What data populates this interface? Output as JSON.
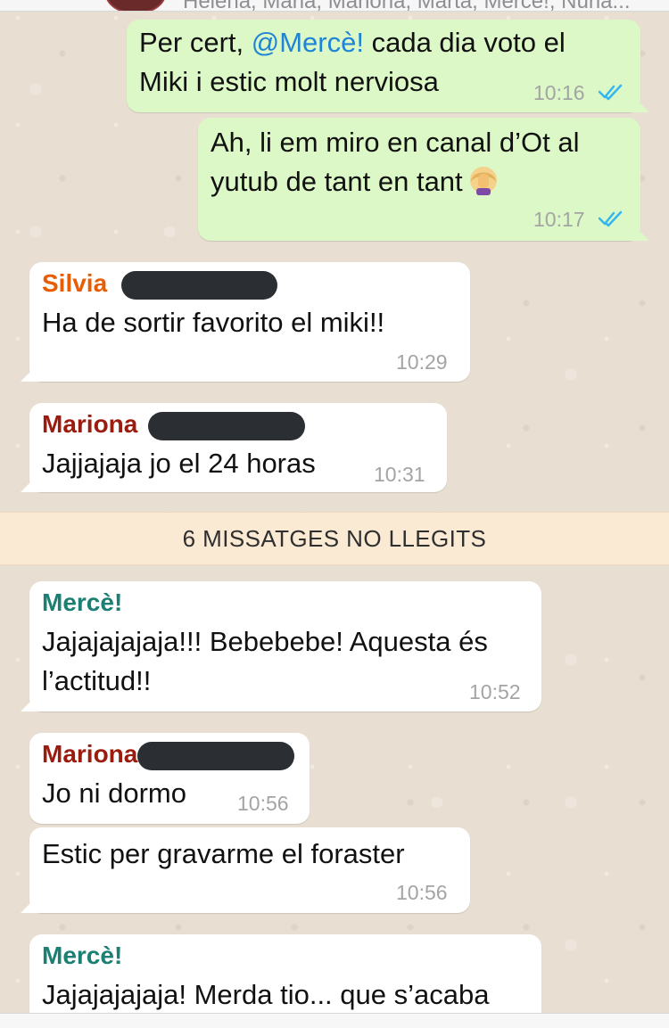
{
  "header": {
    "members_text": "Helena, Maria, Mariona, Marta, Mercè!, Núria..."
  },
  "messages": [
    {
      "direction": "out",
      "text_prefix": "Per cert, ",
      "mention": "@Mercè!",
      "text_suffix": " cada dia voto el",
      "line2": "Miki i estic molt nerviosa",
      "time": "10:16",
      "status": "read"
    },
    {
      "direction": "out",
      "line1": "Ah, li em miro en canal d’Ot al",
      "line2": "yutub de tant en tant",
      "emoji": "face-palm-woman-icon",
      "time": "10:17",
      "status": "read"
    },
    {
      "direction": "in",
      "sender": "Silvia",
      "sender_color": "#e85d04",
      "text": "Ha de sortir favorito el miki!!",
      "time": "10:29"
    },
    {
      "direction": "in",
      "sender": "Mariona",
      "sender_color": "#9b1b0f",
      "text": "Jajjajaja jo el 24 horas",
      "time": "10:31"
    },
    {
      "direction": "in",
      "sender": "Mercè!",
      "sender_color": "#1b7f73",
      "line1": "Jajajajajaja!!! Bebebebe! Aquesta és",
      "line2": "l’actitud!!",
      "time": "10:52"
    },
    {
      "direction": "in",
      "sender": "Mariona",
      "sender_color": "#9b1b0f",
      "text": "Jo ni dormo",
      "time": "10:56"
    },
    {
      "direction": "in",
      "text": "Estic per gravarme el foraster",
      "time": "10:56"
    },
    {
      "direction": "in",
      "sender": "Mercè!",
      "sender_color": "#1b7f73",
      "text": "Jajajajajaja! Merda tio... que s’acaba"
    }
  ],
  "unread_banner": "6 MISSATGES NO LLEGITS",
  "colors": {
    "outgoing_bubble": "#dcf8c6",
    "incoming_bubble": "#ffffff",
    "read_check": "#34b7f1",
    "mention": "#1f84d6",
    "unread_banner": "#fbead3"
  }
}
